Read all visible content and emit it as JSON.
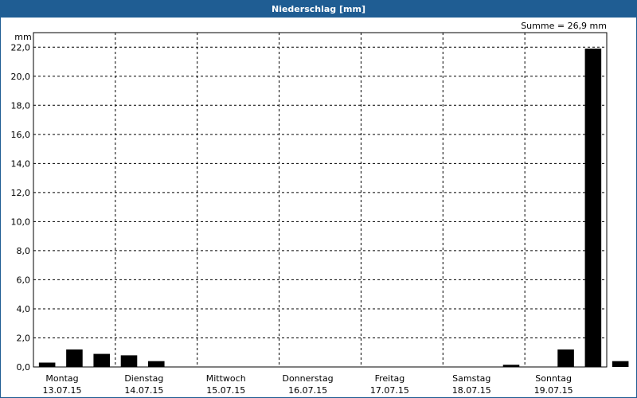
{
  "window": {
    "title": "Niederschlag [mm]"
  },
  "chart_data": {
    "type": "bar",
    "title": "Niederschlag [mm]",
    "ylabel": "mm",
    "summary": "Summe = 26,9 mm",
    "ylim": [
      0,
      23
    ],
    "yticks": [
      0.0,
      2.0,
      4.0,
      6.0,
      8.0,
      10.0,
      12.0,
      14.0,
      16.0,
      18.0,
      20.0,
      22.0
    ],
    "ytick_labels": [
      "0,0",
      "2,0",
      "4,0",
      "6,0",
      "8,0",
      "10,0",
      "12,0",
      "14,0",
      "16,0",
      "18,0",
      "20,0",
      "22,0"
    ],
    "days": [
      {
        "name": "Montag",
        "date": "13.07.15"
      },
      {
        "name": "Dienstag",
        "date": "14.07.15"
      },
      {
        "name": "Mittwoch",
        "date": "15.07.15"
      },
      {
        "name": "Donnerstag",
        "date": "16.07.15"
      },
      {
        "name": "Freitag",
        "date": "17.07.15"
      },
      {
        "name": "Samstag",
        "date": "18.07.15"
      },
      {
        "name": "Sonntag",
        "date": "19.07.15"
      }
    ],
    "bins_per_day": 3,
    "values": [
      0.3,
      1.2,
      0.9,
      0.8,
      0.4,
      0.0,
      0.0,
      0.0,
      0.0,
      0.0,
      0.0,
      0.0,
      0.0,
      0.0,
      0.0,
      0.0,
      0.0,
      0.15,
      0.0,
      1.2,
      21.9,
      0.4
    ],
    "grid": true,
    "bar_color": "#000000",
    "frame_color": "#1f5d93"
  }
}
